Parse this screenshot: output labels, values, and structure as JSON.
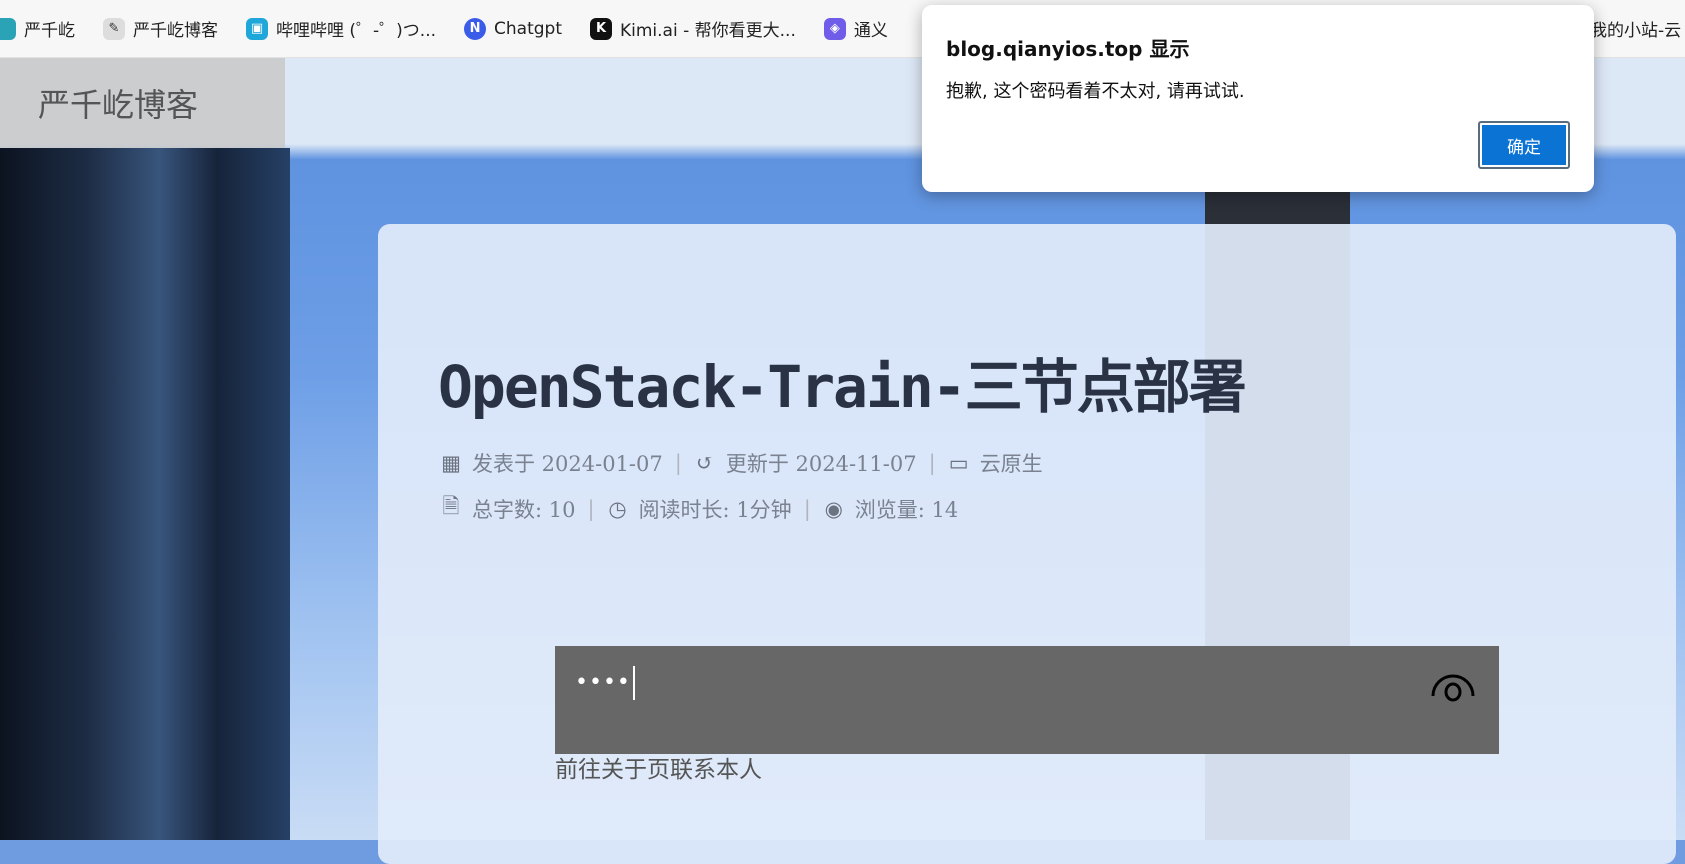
{
  "bookmarks": [
    {
      "label": "严千屹",
      "icon": "feather-icon",
      "color": "#29a3b5"
    },
    {
      "label": "严千屹博客",
      "icon": "logo-icon",
      "color": "#666666"
    },
    {
      "label": "哔哩哔哩 (゜-゜)つ...",
      "icon": "bilibili-icon",
      "color": "#20a7d9"
    },
    {
      "label": "Chatgpt",
      "icon": "chatgpt-icon",
      "color": "#3b5ce8"
    },
    {
      "label": "Kimi.ai - 帮你看更大...",
      "icon": "kimi-icon",
      "color": "#111111"
    },
    {
      "label": "通义",
      "icon": "tongyi-icon",
      "color": "#6f5ce8"
    },
    {
      "label": "我的小站-云",
      "icon": "",
      "color": ""
    }
  ],
  "header": {
    "site_title": "严千屹博客"
  },
  "post": {
    "title": "OpenStack-Train-三节点部署",
    "published": "发表于 2024-01-07",
    "updated": "更新于 2024-11-07",
    "category": "云原生",
    "word_count": "总字数: 10",
    "read_time": "阅读时长: 1分钟",
    "views": "浏览量: 14"
  },
  "password": {
    "value": "••••"
  },
  "contact_link": "前往关于页联系本人",
  "dialog": {
    "title": "blog.qianyios.top 显示",
    "message": "抱歉, 这个密码看着不太对, 请再试试.",
    "ok_label": "确定",
    "button_color": "#0b73d4"
  }
}
